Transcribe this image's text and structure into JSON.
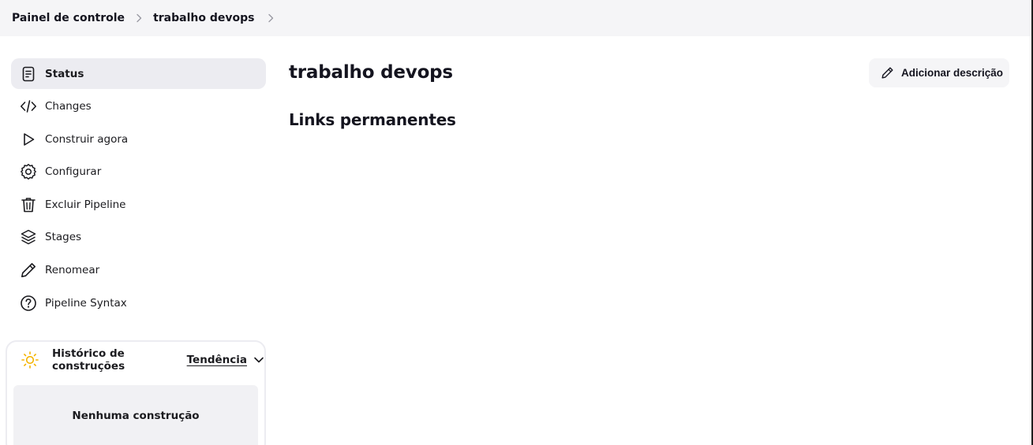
{
  "breadcrumb": {
    "items": [
      "Painel de controle",
      "trabalho devops"
    ]
  },
  "sidebar": {
    "items": [
      {
        "label": "Status",
        "icon": "document-icon",
        "active": true
      },
      {
        "label": "Changes",
        "icon": "code-icon"
      },
      {
        "label": "Construir agora",
        "icon": "play-icon"
      },
      {
        "label": "Configurar",
        "icon": "gear-icon"
      },
      {
        "label": "Excluir Pipeline",
        "icon": "trash-icon"
      },
      {
        "label": "Stages",
        "icon": "layers-icon"
      },
      {
        "label": "Renomear",
        "icon": "pencil-icon"
      },
      {
        "label": "Pipeline Syntax",
        "icon": "help-circle-icon"
      }
    ]
  },
  "history": {
    "title": "Histórico de construções",
    "trend": "Tendência",
    "empty": "Nenhuma construção",
    "icon": "sun-icon",
    "icon_color": "#f4b400"
  },
  "main": {
    "title": "trabalho devops",
    "section": "Links permanentes",
    "add_description": "Adicionar descrição"
  },
  "colors": {
    "topbar_bg": "#f5f5f7",
    "active_item_bg": "#ececf1",
    "text": "#14141f"
  }
}
